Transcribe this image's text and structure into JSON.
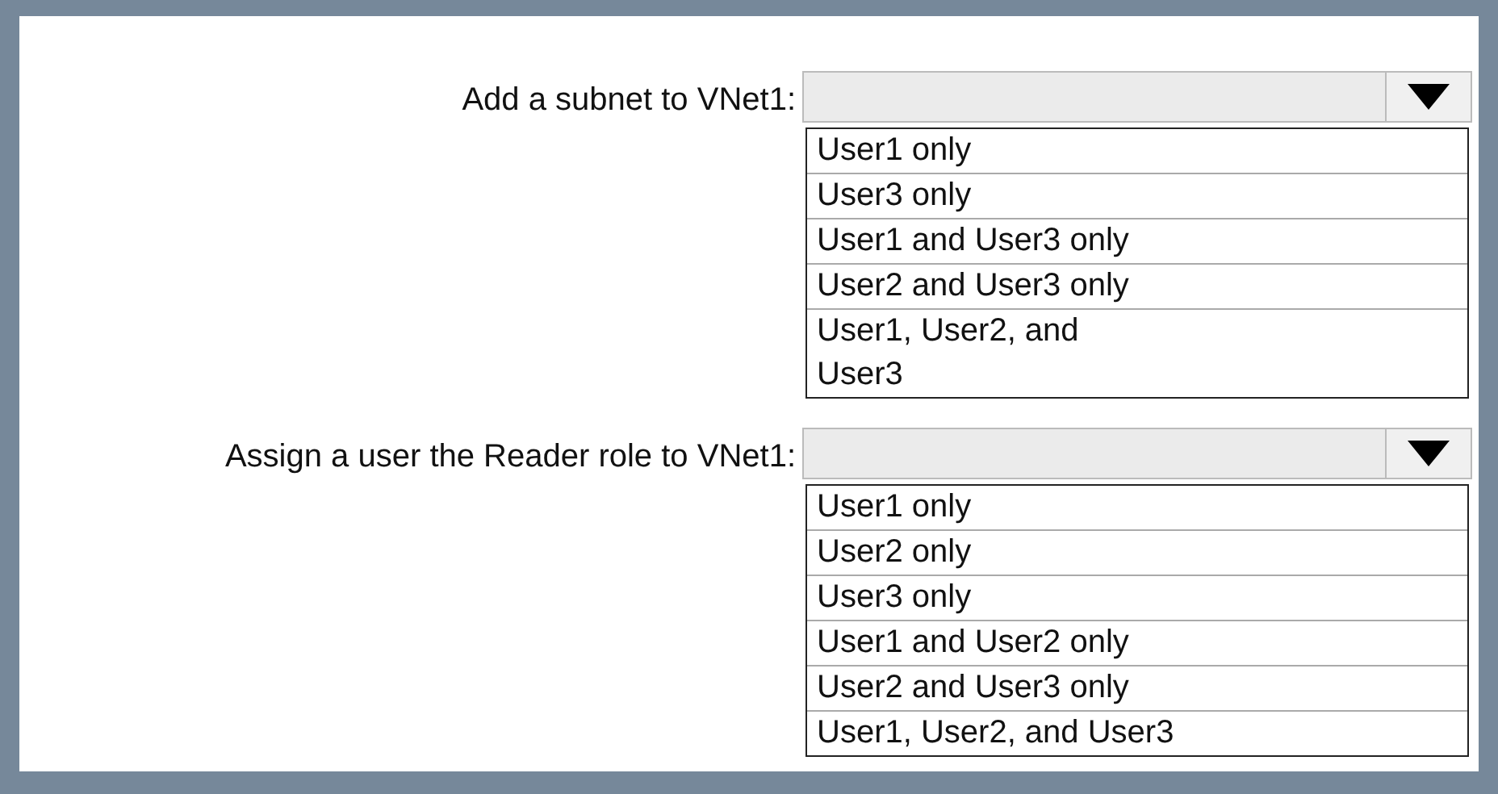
{
  "questions": [
    {
      "label": "Add a subnet to VNet1:",
      "options": [
        "User1 only",
        "User3 only",
        "User1 and User3 only",
        "User2 and User3 only",
        "User1, User2, and\nUser3"
      ]
    },
    {
      "label": "Assign a user the Reader role to VNet1:",
      "options": [
        "User1 only",
        "User2 only",
        "User3 only",
        "User1 and User2 only",
        "User2 and User3 only",
        "User1, User2, and User3"
      ]
    }
  ]
}
